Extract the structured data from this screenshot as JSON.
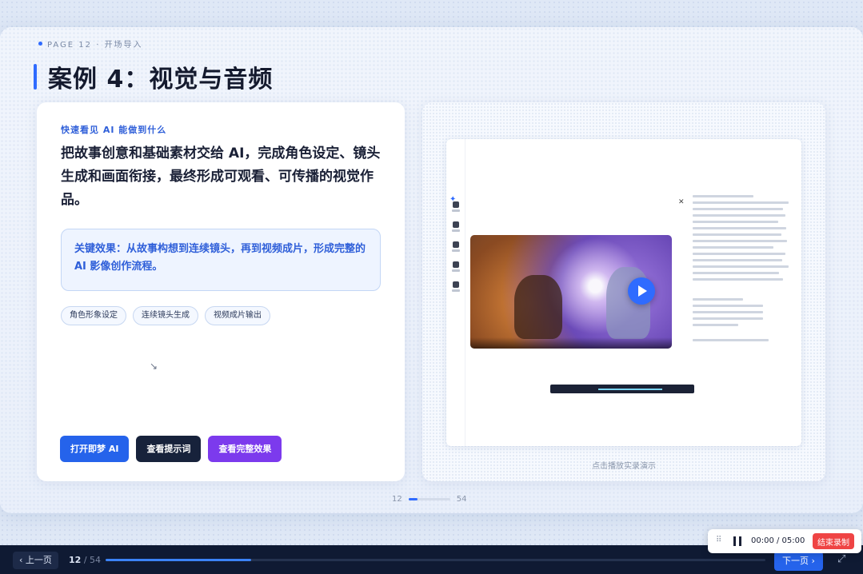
{
  "header": {
    "page_tag": "PAGE 12 · 开场导入",
    "title": "案例 4：视觉与音频"
  },
  "left_card": {
    "kicker": "快速看见 AI 能做到什么",
    "lead": "把故事创意和基础素材交给 AI，完成角色设定、镜头生成和画面衔接，最终形成可观看、可传播的视觉作品。",
    "effect": "关键效果：从故事构想到连续镜头，再到视频成片，形成完整的 AI 影像创作流程。",
    "chips": [
      "角色形象设定",
      "连续镜头生成",
      "视频成片输出"
    ],
    "buttons": {
      "open_jimeng": "打开即梦 AI",
      "view_prompt": "查看提示词",
      "view_full": "查看完整效果"
    }
  },
  "right_card": {
    "caption": "点击播放实录演示"
  },
  "pager": {
    "current": "12",
    "total": "54",
    "progress": 0.22
  },
  "bottom_bar": {
    "prev_label": "‹ 上一页",
    "current": "12",
    "total": "/ 54",
    "next_label": "下一页 ›",
    "progress": 0.22
  },
  "recorder": {
    "time": "00:00 / 05:00",
    "stop_label": "结束录制"
  },
  "colors": {
    "accent": "#2f6bff",
    "dark": "#17223b",
    "purple": "#7c3aed",
    "stop": "#ef4444"
  }
}
